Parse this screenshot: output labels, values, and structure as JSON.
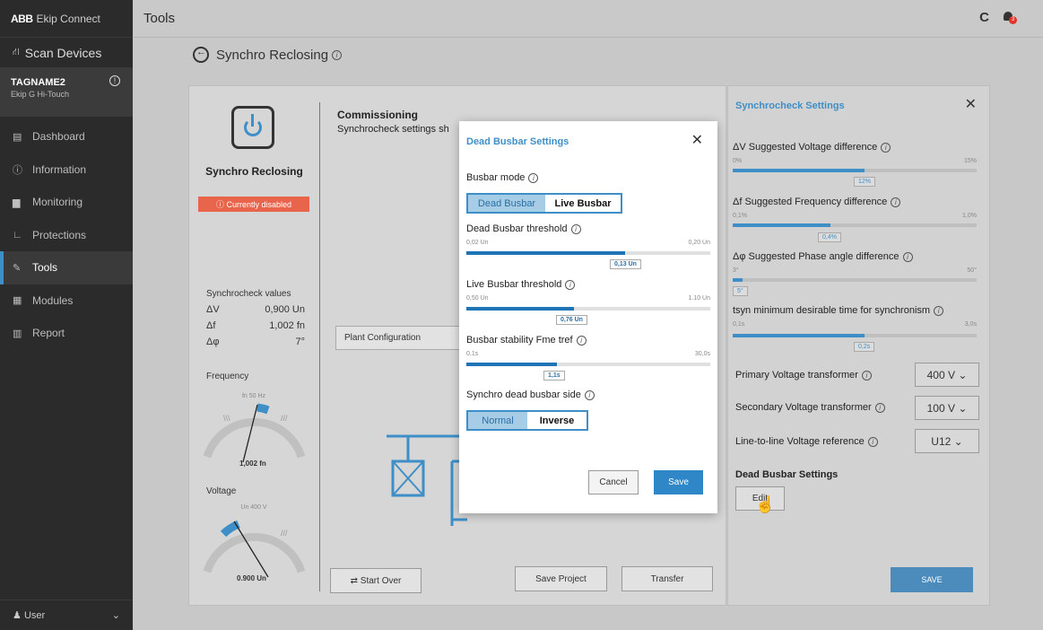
{
  "app": {
    "brand": "ABB",
    "name": "Ekip Connect"
  },
  "sidebar": {
    "scan": "Scan Devices",
    "device": {
      "name": "TAGNAME2",
      "type": "Ekip G Hi-Touch"
    },
    "items": [
      {
        "label": "Dashboard"
      },
      {
        "label": "Information"
      },
      {
        "label": "Monitoring"
      },
      {
        "label": "Protections"
      },
      {
        "label": "Tools"
      },
      {
        "label": "Modules"
      },
      {
        "label": "Report"
      }
    ],
    "user": "User"
  },
  "topbar": {
    "title": "Tools",
    "badge_count": "3"
  },
  "page": {
    "title": "Synchro Reclosing"
  },
  "left": {
    "title": "Synchro Reclosing",
    "status": "Currently disabled",
    "sv_title": "Synchrocheck values",
    "sv": [
      {
        "sym": "ΔV",
        "val": "0,900 Un"
      },
      {
        "sym": "Δf",
        "val": "1,002 fn"
      },
      {
        "sym": "Δφ",
        "val": "7°"
      }
    ],
    "freq": {
      "label": "Frequency",
      "ref": "fn 50 Hz",
      "value": "1,002 fn"
    },
    "volt": {
      "label": "Voltage",
      "ref": "Un 400 V",
      "value": "0.900 Un"
    }
  },
  "commissioning": {
    "title": "Commissioning",
    "subtitle": "Synchrocheck settings sh"
  },
  "buttons": {
    "plant": "Plant Configuration",
    "start_over": "Start Over",
    "save_project": "Save Project",
    "transfer": "Transfer"
  },
  "rpanel": {
    "title": "Synchrocheck Settings",
    "sliders": [
      {
        "label": "ΔV Suggested Voltage difference",
        "min": "0%",
        "max": "15%",
        "value": "12%",
        "fraction": 0.54
      },
      {
        "label": "Δf Suggested Frequency difference",
        "min": "0,1%",
        "max": "1,0%",
        "value": "0,4%",
        "fraction": 0.4
      },
      {
        "label": "Δφ Suggested Phase angle difference",
        "min": "3°",
        "max": "50°",
        "value": "5°",
        "fraction": 0.04
      },
      {
        "label": "tsyn minimum desirable time for synchronism",
        "min": "0,1s",
        "max": "3,0s",
        "value": "0,2s",
        "fraction": 0.54
      }
    ],
    "fields": [
      {
        "label": "Primary Voltage transformer",
        "value": "400 V"
      },
      {
        "label": "Secondary Voltage transformer",
        "value": "100 V"
      },
      {
        "label": "Line-to-line Voltage reference",
        "value": "U12"
      }
    ],
    "dead_busbar_title": "Dead Busbar Settings",
    "edit": "Edit",
    "save": "SAVE"
  },
  "modal": {
    "title": "Dead Busbar Settings",
    "mode_label": "Busbar mode",
    "mode_options": [
      "Dead Busbar",
      "Live Busbar"
    ],
    "sliders": [
      {
        "label": "Dead Busbar threshold",
        "min": "0,02 Un",
        "max": "0,20 Un",
        "value": "0,13 Un",
        "fraction": 0.65
      },
      {
        "label": "Live Busbar threshold",
        "min": "0,50 Un",
        "max": "1.10 Un",
        "value": "0,76 Un",
        "fraction": 0.44
      },
      {
        "label": "Busbar stability Fme tref",
        "min": "0,1s",
        "max": "30,0s",
        "value": "1,1s",
        "fraction": 0.37
      }
    ],
    "side_label": "Synchro dead busbar side",
    "side_options": [
      "Normal",
      "Inverse"
    ],
    "cancel": "Cancel",
    "save": "Save"
  },
  "colors": {
    "accent": "#3e8fc7",
    "warning": "#e8644a",
    "sidebar": "#2b2b2b"
  }
}
